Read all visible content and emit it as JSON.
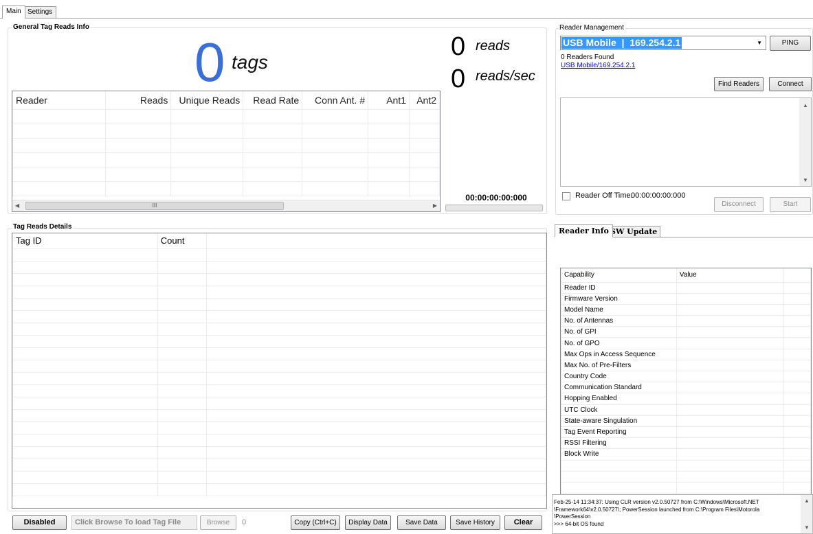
{
  "tabs": [
    "Main",
    "Settings"
  ],
  "general": {
    "title": "General Tag Reads Info",
    "tags_count": "0",
    "tags_label": "tags",
    "reads_count": "0",
    "reads_label": "reads",
    "rate_count": "0",
    "rate_label": "reads/sec",
    "timer": "00:00:00:00:000",
    "columns": [
      "Reader",
      "Reads",
      "Unique Reads",
      "Read Rate",
      "Conn Ant. #",
      "Ant1",
      "Ant2"
    ],
    "scroll_thumb_label": "III"
  },
  "reader_mgmt": {
    "title": "Reader Management",
    "selected_reader": "USB Mobile  |  169.254.2.1",
    "ping_label": "PING",
    "found_text": "0 Readers Found",
    "reader_link": "USB Mobile/169.254.2.1",
    "find_label": "Find Readers",
    "connect_label": "Connect",
    "off_time_label": "Reader Off Time:",
    "off_time_value": "00:00:00:00:000",
    "disconnect_label": "Disconnect",
    "start_label": "Start"
  },
  "details": {
    "title": "Tag Reads Details",
    "columns": [
      "Tag ID",
      "Count"
    ]
  },
  "info_tabs": [
    "Reader Info",
    "SW Update"
  ],
  "capabilities": {
    "columns": [
      "Capability",
      "Value"
    ],
    "rows": [
      "Reader ID",
      "Firmware Version",
      "Model Name",
      "No. of Antennas",
      "No. of GPI",
      "No. of GPO",
      "Max Ops in Access Sequence",
      "Max No. of Pre-Filters",
      "Country Code",
      "Communication Standard",
      "Hopping Enabled",
      "UTC Clock",
      "State-aware Singulation",
      "Tag Event Reporting",
      "RSSI Filtering",
      "Block Write"
    ]
  },
  "log": {
    "line1": "Feb-25-14 11:34:37: Using CLR version v2.0.50727 from C:\\Windows\\Microsoft.NET",
    "line2": "\\Framework64\\v2.0.50727\\; PowerSession launched from C:\\Program Files\\Motorola",
    "line3": "\\PowerSession",
    "line4": ">>> 64-bit OS found"
  },
  "bottom": {
    "disabled_label": "Disabled",
    "browse_placeholder": "Click Browse To load Tag File",
    "browse_label": "Browse",
    "file_count": "0",
    "copy_label": "Copy (Ctrl+C)",
    "display_label": "Display Data",
    "save_label": "Save Data",
    "history_label": "Save History",
    "clear_label": "Clear"
  },
  "colors": {
    "accent_blue": "#3b6fd8",
    "arc_blue": "#1c7fc6",
    "link": "#0000ee",
    "selection": "#3399ff"
  }
}
